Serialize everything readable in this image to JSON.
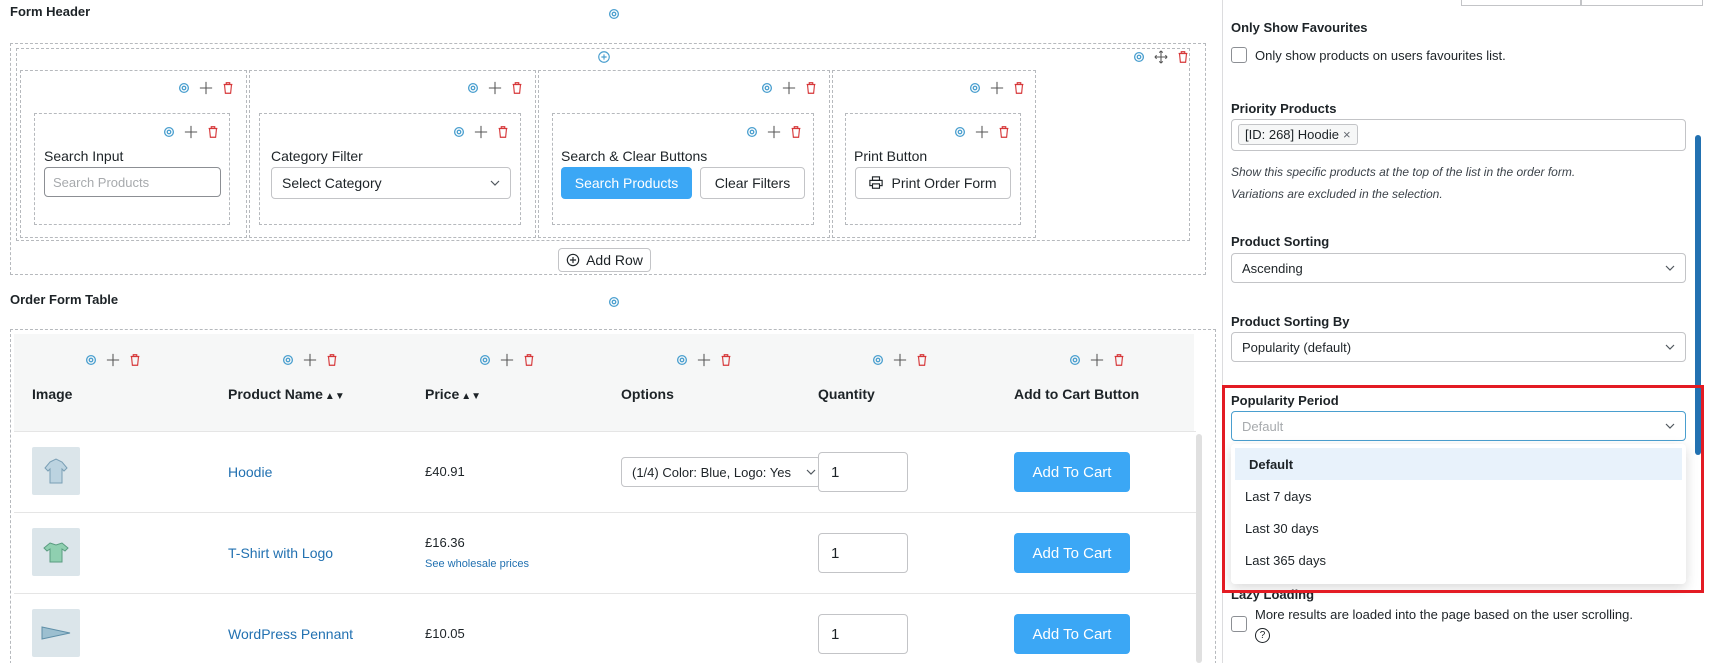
{
  "form_header": {
    "title": "Form Header",
    "columns": [
      {
        "label": "Search Input",
        "placeholder": "Search Products"
      },
      {
        "label": "Category Filter",
        "select_value": "Select Category"
      },
      {
        "label": "Search & Clear Buttons",
        "search_button": "Search Products",
        "clear_button": "Clear Filters"
      },
      {
        "label": "Print Button",
        "print_button": "Print Order Form"
      }
    ],
    "add_row_label": "Add Row"
  },
  "order_table": {
    "title": "Order Form Table",
    "headers": [
      "Image",
      "Product Name",
      "Price",
      "Options",
      "Quantity",
      "Add to Cart Button"
    ],
    "rows": [
      {
        "name": "Hoodie",
        "price": "£40.91",
        "option": "(1/4) Color: Blue, Logo: Yes",
        "qty": "1",
        "cart": "Add To Cart"
      },
      {
        "name": "T-Shirt with Logo",
        "price": "£16.36",
        "wholesale": "See wholesale prices",
        "qty": "1",
        "cart": "Add To Cart"
      },
      {
        "name": "WordPress Pennant",
        "price": "£10.05",
        "qty": "1",
        "cart": "Add To Cart"
      }
    ]
  },
  "panel": {
    "favourites": {
      "title": "Only Show Favourites",
      "checkbox_label": "Only show products on users favourites list."
    },
    "priority": {
      "title": "Priority Products",
      "tag": "[ID: 268] Hoodie",
      "remove": "×",
      "help_line1": "Show this specific products at the top of the list in the order form.",
      "help_line2": "Variations are excluded in the selection."
    },
    "sorting": {
      "title": "Product Sorting",
      "value": "Ascending"
    },
    "sorting_by": {
      "title": "Product Sorting By",
      "value": "Popularity (default)"
    },
    "popularity": {
      "title": "Popularity Period",
      "placeholder": "Default",
      "options": [
        "Default",
        "Last 7 days",
        "Last 30 days",
        "Last 365 days"
      ]
    },
    "lazy": {
      "title": "Lazy Loading",
      "checkbox_label": "More results are loaded into the page based on the user scrolling.",
      "help_icon": "?"
    }
  },
  "colors": {
    "accent": "#3ba7f5",
    "link": "#2271b1",
    "highlight": "#e31b23",
    "delete": "#d63638"
  },
  "icons": {
    "settings": "gear-icon",
    "move": "move-icon",
    "delete": "trash-icon",
    "add": "plus-circle-icon",
    "print": "printer-icon"
  }
}
